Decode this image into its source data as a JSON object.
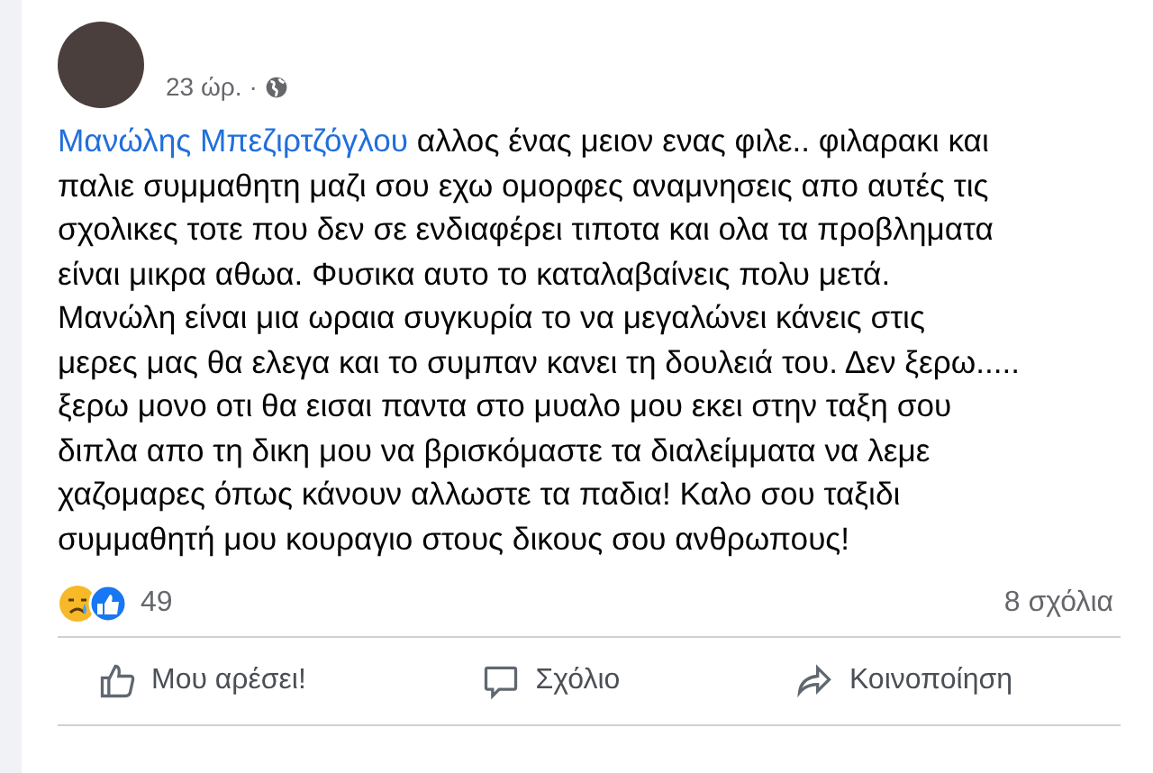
{
  "post": {
    "time": "23 ώρ.",
    "separator": "·",
    "mention": "Μανώλης Μπεζιρτζόγλου",
    "lines": [
      " αλλος ένας μειον ενας φιλε.. φιλαρακι και",
      "παλιε συμμαθητη μαζι σου εχω ομορφες αναμνησεις απο αυτές τις",
      "σχολικες τοτε που δεν σε ενδιαφέρει τιποτα και ολα τα προβληματα",
      "είναι μικρα αθωα. Φυσικα αυτο το καταλαβαίνεις πολυ μετά.",
      "Μανώλη είναι μια ωραια συγκυρία το να μεγαλώνει κάνεις στις",
      "μερες μας θα ελεγα και το συμπαν κανει τη δουλειά του. Δεν ξερω.....",
      "ξερω μονο οτι θα εισαι παντα στο μυαλο μου εκει στην ταξη σου",
      "διπλα απο τη δικη μου να βρισκόμαστε τα διαλείμματα να λεμε",
      "χαζομαρες όπως κάνουν αλλωστε τα παδια! Καλο σου ταξιδι",
      "συμμαθητή μου κουραγιο στους δικους σου ανθρωπους!"
    ]
  },
  "reactions": {
    "count": "49",
    "comments": "8 σχόλια"
  },
  "actions": [
    {
      "kind": "like",
      "label": "Μου αρέσει!"
    },
    {
      "kind": "comment",
      "label": "Σχόλιο"
    },
    {
      "kind": "share",
      "label": "Κοινοποίηση"
    }
  ]
}
